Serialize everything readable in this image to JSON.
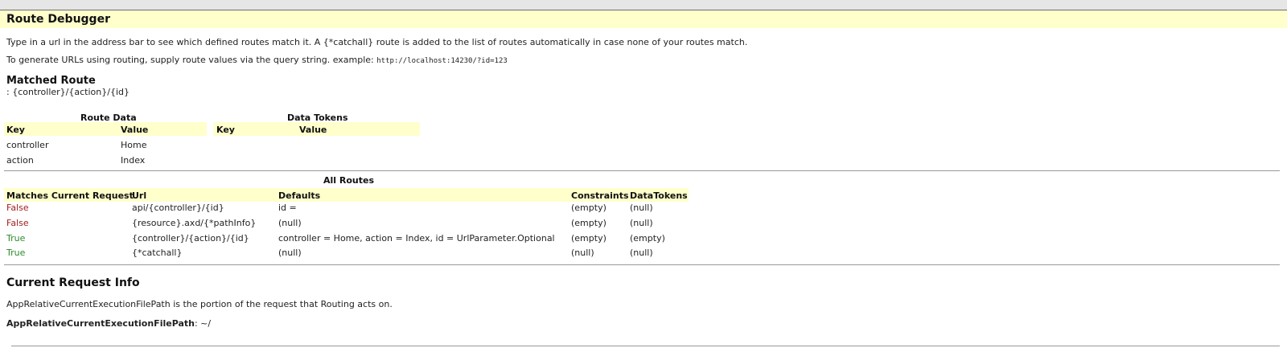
{
  "page": {
    "title": "Route Debugger",
    "intro": "Type in a url in the address bar to see which defined routes match it. A {*catchall} route is added to the list of routes automatically in case none of your routes match.",
    "generate_text": "To generate URLs using routing, supply route values via the query string. example:",
    "example_url": "http://localhost:14230/?id=123"
  },
  "matched_route": {
    "heading": "Matched Route",
    "value": ": {controller}/{action}/{id}"
  },
  "route_data": {
    "title": "Route Data",
    "key_header": "Key",
    "value_header": "Value",
    "rows": [
      {
        "key": "controller",
        "value": "Home"
      },
      {
        "key": "action",
        "value": "Index"
      }
    ]
  },
  "data_tokens": {
    "title": "Data Tokens",
    "key_header": "Key",
    "value_header": "Value"
  },
  "all_routes": {
    "title": "All Routes",
    "headers": {
      "matches": "Matches Current Request",
      "url": "Url",
      "defaults": "Defaults",
      "constraints": "Constraints",
      "datatokens": "DataTokens"
    },
    "rows": [
      {
        "matches": "False",
        "url": "api/{controller}/{id}",
        "defaults": "id =",
        "constraints": "(empty)",
        "datatokens": "(null)"
      },
      {
        "matches": "False",
        "url": "{resource}.axd/{*pathInfo}",
        "defaults": "(null)",
        "constraints": "(empty)",
        "datatokens": "(null)"
      },
      {
        "matches": "True",
        "url": "{controller}/{action}/{id}",
        "defaults": "controller = Home, action = Index, id = UrlParameter.Optional",
        "constraints": "(empty)",
        "datatokens": "(empty)"
      },
      {
        "matches": "True",
        "url": "{*catchall}",
        "defaults": "(null)",
        "constraints": "(null)",
        "datatokens": "(null)"
      }
    ]
  },
  "current_request": {
    "heading": "Current Request Info",
    "description": "AppRelativeCurrentExecutionFilePath is the portion of the request that Routing acts on.",
    "label": "AppRelativeCurrentExecutionFilePath",
    "value": ": ~/"
  },
  "colors": {
    "header_bg": "#ffffcc",
    "false_text": "#a32020",
    "true_text": "#2e8a2e"
  }
}
